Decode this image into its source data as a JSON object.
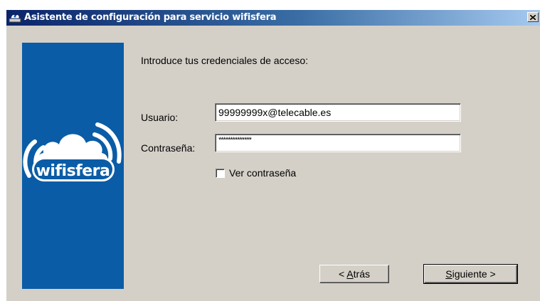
{
  "window": {
    "title": "Asistente de configuración para servicio wifisfera",
    "close_icon": "close-icon"
  },
  "brand": {
    "name": "wifisfera",
    "icon": "wifi-cloud-icon",
    "panel_color": "#0a5ca6"
  },
  "form": {
    "heading": "Introduce tus credenciales de acceso:",
    "username_label": "Usuario:",
    "username_value": "99999999x@telecable.es",
    "password_label": "Contraseña:",
    "password_value": "**************",
    "show_password_label": "Ver contraseña",
    "show_password_checked": false
  },
  "buttons": {
    "back": {
      "accel": "A",
      "rest": "trás",
      "prefix": "< "
    },
    "next": {
      "accel": "S",
      "rest": "iguiente",
      "suffix": " >"
    }
  }
}
